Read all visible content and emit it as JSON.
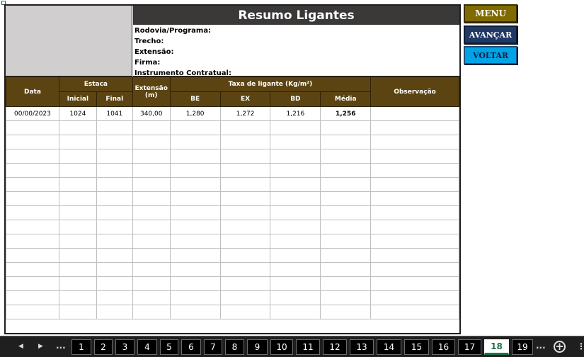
{
  "sheet": {
    "title": "Resumo Ligantes",
    "info": [
      "Rodovia/Programa:",
      "Trecho:",
      "Extensão:",
      "Firma:",
      "Instrumento Contratual:"
    ],
    "headers": {
      "data": "Data",
      "estaca": "Estaca",
      "inicial": "Inicial",
      "final": "Final",
      "extensao": "Extensão",
      "extensao_unit": "(m)",
      "taxa": "Taxa de ligante (Kg/m²)",
      "be": "BE",
      "ex": "EX",
      "bd": "BD",
      "media": "Média",
      "observacao": "Observação"
    },
    "rows": [
      [
        "00/00/2023",
        "1024",
        "1041",
        "340,00",
        "1,280",
        "1,272",
        "1,216",
        "1,256",
        ""
      ]
    ],
    "empty_rows": 14
  },
  "buttons": {
    "menu": "MENU",
    "avancar": "AVANÇAR",
    "voltar": "VOLTAR"
  },
  "tabbar": {
    "prev_icon": "triangle-left-icon",
    "next_icon": "triangle-right-icon",
    "left_ellipsis": "...",
    "tabs": [
      "1",
      "2",
      "3",
      "4",
      "5",
      "6",
      "7",
      "8",
      "9",
      "10",
      "11",
      "12",
      "13",
      "14",
      "15",
      "16",
      "17",
      "18",
      "19"
    ],
    "active_tab": "18",
    "right_ellipsis": "...",
    "add_sheet": "+",
    "more": "⋮"
  },
  "colors": {
    "title_bar": "#3b3838",
    "header_brown": "#5c4412",
    "menu_button": "#7f6a00",
    "avancar_button": "#203864",
    "voltar_button": "#00a3e6",
    "active_tab_text": "#1e7145"
  }
}
